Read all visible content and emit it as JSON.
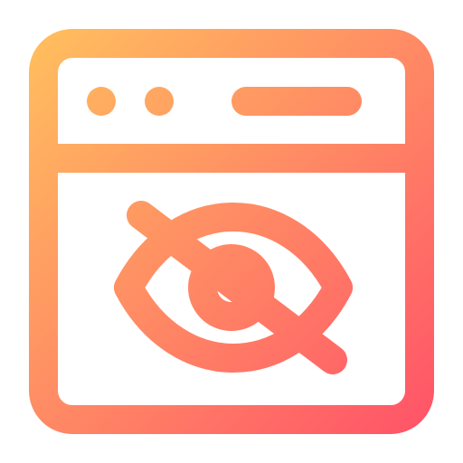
{
  "icon": {
    "name": "hidden-browser-window-icon",
    "colors": {
      "gradient_start": "#FFBE5E",
      "gradient_mid": "#FF8A64",
      "gradient_end": "#FF5468",
      "background": "#FFFFFF"
    }
  }
}
